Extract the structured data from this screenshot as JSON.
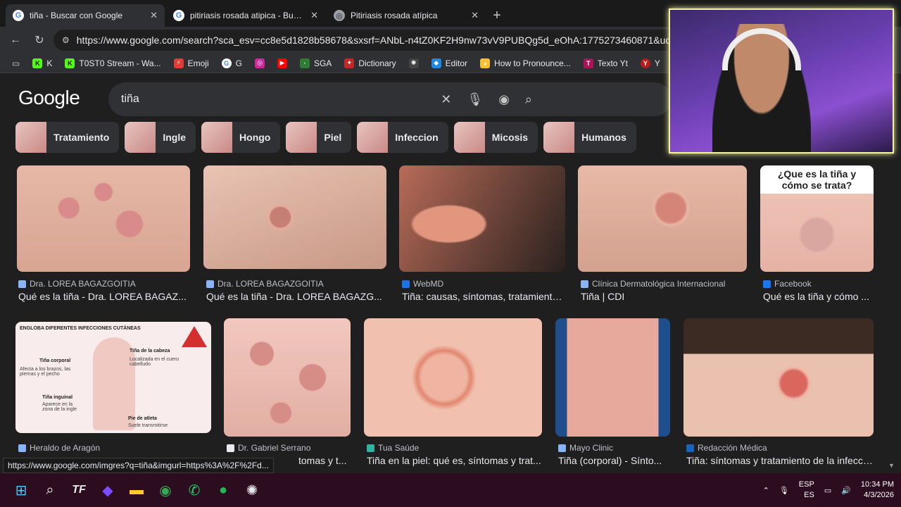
{
  "tabs": [
    {
      "title": "tiña - Buscar con Google",
      "active": true
    },
    {
      "title": "pitiriasis rosada atipica - Buscar con Google",
      "active": false
    },
    {
      "title": "Pitiriasis rosada atípica",
      "active": false
    }
  ],
  "address": "https://www.google.com/search?sca_esv=cc8e5d1828b58678&sxsrf=ANbL-n4tZ0KF2H9nw73vV9PUBQg5d_eOhA:1775273460871&udm=2&fbs=A",
  "bookmarks": [
    "K",
    "T0ST0 Stream - Wa...",
    "Emoji",
    "G",
    "",
    "",
    "SGA",
    "Dictionary",
    "",
    "Editor",
    "How to Pronounce...",
    "Texto Yt",
    "Y"
  ],
  "search": {
    "logo": "Google",
    "query": "tiña"
  },
  "chips": [
    "Tratamiento",
    "Ingle",
    "Hongo",
    "Piel",
    "Infeccion",
    "Micosis",
    "Humanos"
  ],
  "row1": [
    {
      "source": "Dra. LOREA BAGAZGOITIA",
      "caption": "Qué es la tiña - Dra. LOREA BAGAZ..."
    },
    {
      "source": "Dra. LOREA BAGAZGOITIA",
      "caption": "Qué es la tiña - Dra. LOREA BAGAZG..."
    },
    {
      "source": "WebMD",
      "caption": "Tiña: causas, síntomas, tratamiento..."
    },
    {
      "source": "Clínica Dermatológica Internacional",
      "caption": "Tiña | CDI"
    },
    {
      "source": "Facebook",
      "caption": "Qué es la tiña y cómo ..."
    }
  ],
  "overlay_text": "¿Que es la tiña y cómo se trata?",
  "infographic": {
    "header": "ENGLOBA DIFERENTES INFECCIONES CUTÁNEAS",
    "labels": [
      "Tiña de la cabeza",
      "Localizada en el cuero cabelludo",
      "Tiña corporal",
      "Afecta a los brazos, las piernas y el pecho",
      "Tiña inguinal",
      "Aparece en la zona de la ingle",
      "Pie de atleta",
      "Suele transmitirse"
    ]
  },
  "row2": [
    {
      "source": "Heraldo de Aragón",
      "caption": ""
    },
    {
      "source": "Dr. Gabriel Serrano",
      "caption": "tomas y t..."
    },
    {
      "source": "Tua Saúde",
      "caption": "Tiña en la piel: qué es, síntomas y trat..."
    },
    {
      "source": "Mayo Clinic",
      "caption": "Tiña (corporal) - Sínto..."
    },
    {
      "source": "Redacción Médica",
      "caption": "Tiña: síntomas y tratamiento de la infección"
    }
  ],
  "status_url": "https://www.google.com/imgres?q=tiña&imgurl=https%3A%2F%2Fd...",
  "tray": {
    "lang1": "ESP",
    "lang2": "ES",
    "time": "10:34 PM",
    "date": "4/3/2026"
  }
}
